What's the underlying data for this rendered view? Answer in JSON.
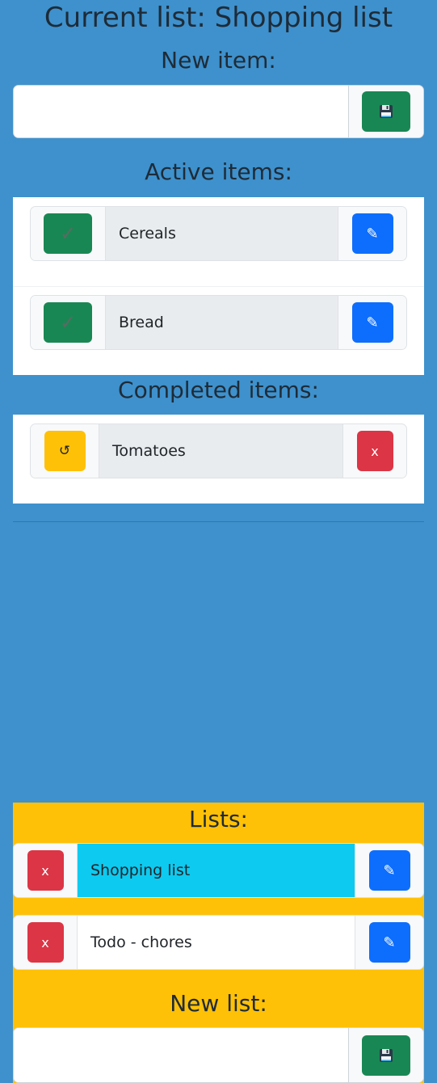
{
  "header": {
    "title": "Current list: Shopping list"
  },
  "new_item": {
    "heading": "New item:",
    "value": "",
    "placeholder": ""
  },
  "active": {
    "heading": "Active items:",
    "items": [
      {
        "label": "Cereals"
      },
      {
        "label": "Bread"
      }
    ]
  },
  "completed": {
    "heading": "Completed items:",
    "items": [
      {
        "label": "Tomatoes"
      }
    ]
  },
  "lists": {
    "heading": "Lists:",
    "items": [
      {
        "label": "Shopping list",
        "selected": true
      },
      {
        "label": "Todo - chores",
        "selected": false
      }
    ]
  },
  "new_list": {
    "heading": "New list:",
    "value": "",
    "placeholder": ""
  },
  "glyphs": {
    "check": "✓",
    "pencil": "✎",
    "undo": "↺",
    "delete": "x"
  },
  "icons": {
    "save": "floppy-disk-icon",
    "complete": "check-icon",
    "edit": "pencil-icon",
    "restore": "undo-icon",
    "delete": "x-icon"
  },
  "colors": {
    "background": "#3e91cc",
    "success": "#198754",
    "primary": "#0d6efd",
    "warning": "#ffc107",
    "danger": "#dc3545",
    "info": "#0dcaf0"
  }
}
